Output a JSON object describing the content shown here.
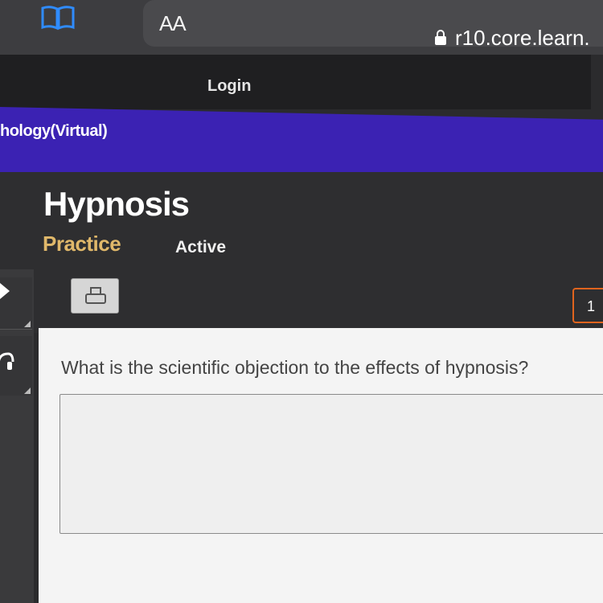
{
  "browser": {
    "text_size_label": "AA",
    "url": "r10.core.learn.",
    "icons": {
      "reader": "book-icon",
      "lock": "lock-icon"
    }
  },
  "nav": {
    "login_label": "Login"
  },
  "course": {
    "title": "hology(Virtual)",
    "bar_color": "#3b22b3"
  },
  "page": {
    "title": "Hypnosis",
    "tabs": [
      {
        "label": "Practice",
        "color": "#e0b86a"
      },
      {
        "label": "Active"
      }
    ]
  },
  "toolbar": {
    "print_icon": "print-icon",
    "page_number": "1",
    "side_icons": [
      "pencil-icon",
      "headphones-icon"
    ]
  },
  "question": {
    "text": "What is the scientific objection to the effects of hypnosis?",
    "answer_value": "",
    "answer_placeholder": ""
  }
}
